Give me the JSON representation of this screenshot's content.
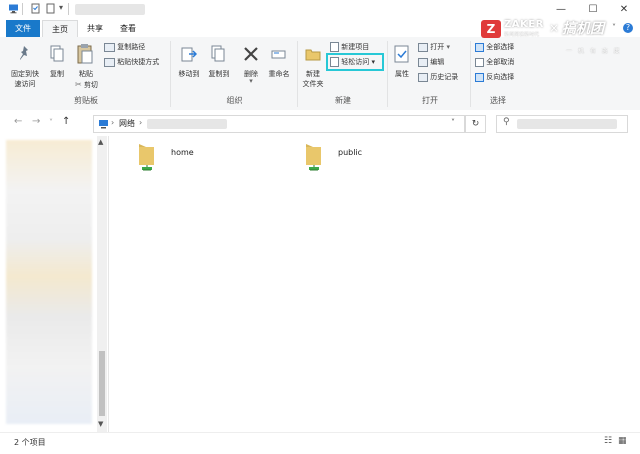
{
  "tabs": [
    "文件",
    "主页",
    "共享",
    "查看"
  ],
  "window_controls": {
    "minimize": "—",
    "maximize": "☐",
    "close": "✕"
  },
  "ribbon": {
    "clipboard": {
      "pin_label_1": "固定到快",
      "pin_label_2": "速访问",
      "copy": "复制",
      "paste": "粘贴",
      "copy_path": "复制路径",
      "paste_shortcut": "粘贴快捷方式",
      "cut": "剪切",
      "group_label": "剪贴板"
    },
    "organize": {
      "move_to": "移动到",
      "copy_to": "复制到",
      "delete": "删除",
      "rename": "重命名",
      "group_label": "组织"
    },
    "new": {
      "new_folder_1": "新建",
      "new_folder_2": "文件夹",
      "new_item": "新建项目",
      "easy_access": "轻松访问",
      "group_label": "新建"
    },
    "open": {
      "properties": "属性",
      "open": "打开",
      "edit": "编辑",
      "history": "历史记录",
      "group_label": "打开"
    },
    "select": {
      "select_all": "全部选择",
      "select_none": "全部取消",
      "invert": "反向选择",
      "group_label": "选择"
    }
  },
  "watermark": {
    "zaker": "ZAKER",
    "zaker_sub": "新闻阅读新时代",
    "cross": "×",
    "tuan": "搞机团",
    "tuan_sub": "一 机 有 态 度"
  },
  "address": {
    "path_root": "网络",
    "separator": "›"
  },
  "folders": [
    {
      "name": "home"
    },
    {
      "name": "public"
    }
  ],
  "status": {
    "item_count": "2 个项目"
  },
  "colors": {
    "file_tab": "#1979ca",
    "highlight_box": "#27c8d6",
    "folder": "#e9c76b",
    "zaker_red": "#e03a3a"
  }
}
